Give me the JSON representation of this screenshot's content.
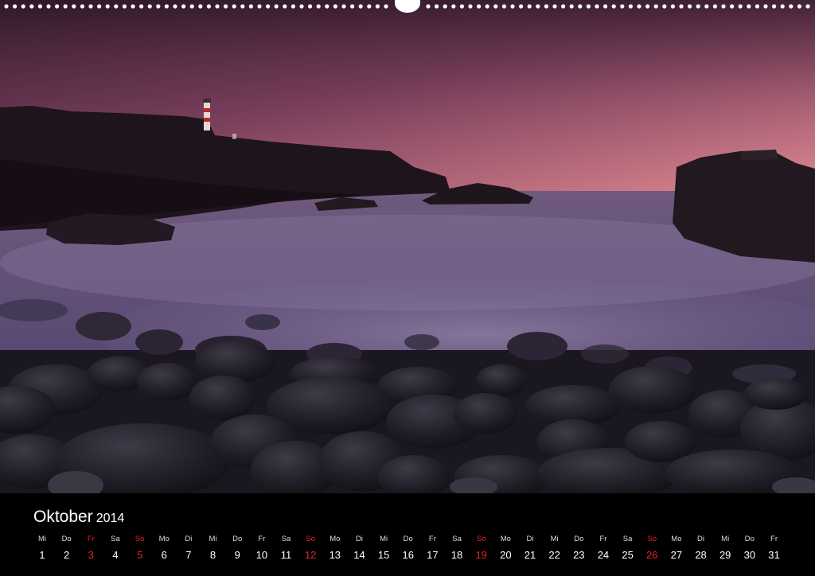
{
  "calendar": {
    "month": "Oktober",
    "year": "2014",
    "days": [
      {
        "wd": "Mi",
        "num": "1",
        "sunday": false
      },
      {
        "wd": "Do",
        "num": "2",
        "sunday": false
      },
      {
        "wd": "Fr",
        "num": "3",
        "sunday": true
      },
      {
        "wd": "Sa",
        "num": "4",
        "sunday": false
      },
      {
        "wd": "So",
        "num": "5",
        "sunday": true
      },
      {
        "wd": "Mo",
        "num": "6",
        "sunday": false
      },
      {
        "wd": "Di",
        "num": "7",
        "sunday": false
      },
      {
        "wd": "Mi",
        "num": "8",
        "sunday": false
      },
      {
        "wd": "Do",
        "num": "9",
        "sunday": false
      },
      {
        "wd": "Fr",
        "num": "10",
        "sunday": false
      },
      {
        "wd": "Sa",
        "num": "11",
        "sunday": false
      },
      {
        "wd": "So",
        "num": "12",
        "sunday": true
      },
      {
        "wd": "Mo",
        "num": "13",
        "sunday": false
      },
      {
        "wd": "Di",
        "num": "14",
        "sunday": false
      },
      {
        "wd": "Mi",
        "num": "15",
        "sunday": false
      },
      {
        "wd": "Do",
        "num": "16",
        "sunday": false
      },
      {
        "wd": "Fr",
        "num": "17",
        "sunday": false
      },
      {
        "wd": "Sa",
        "num": "18",
        "sunday": false
      },
      {
        "wd": "So",
        "num": "19",
        "sunday": true
      },
      {
        "wd": "Mo",
        "num": "20",
        "sunday": false
      },
      {
        "wd": "Di",
        "num": "21",
        "sunday": false
      },
      {
        "wd": "Mi",
        "num": "22",
        "sunday": false
      },
      {
        "wd": "Do",
        "num": "23",
        "sunday": false
      },
      {
        "wd": "Fr",
        "num": "24",
        "sunday": false
      },
      {
        "wd": "Sa",
        "num": "25",
        "sunday": false
      },
      {
        "wd": "So",
        "num": "26",
        "sunday": true
      },
      {
        "wd": "Mo",
        "num": "27",
        "sunday": false
      },
      {
        "wd": "Di",
        "num": "28",
        "sunday": false
      },
      {
        "wd": "Mi",
        "num": "29",
        "sunday": false
      },
      {
        "wd": "Do",
        "num": "30",
        "sunday": false
      },
      {
        "wd": "Fr",
        "num": "31",
        "sunday": false
      }
    ]
  },
  "colors": {
    "background": "#000000",
    "text": "#ffffff",
    "holiday": "#e32626"
  }
}
